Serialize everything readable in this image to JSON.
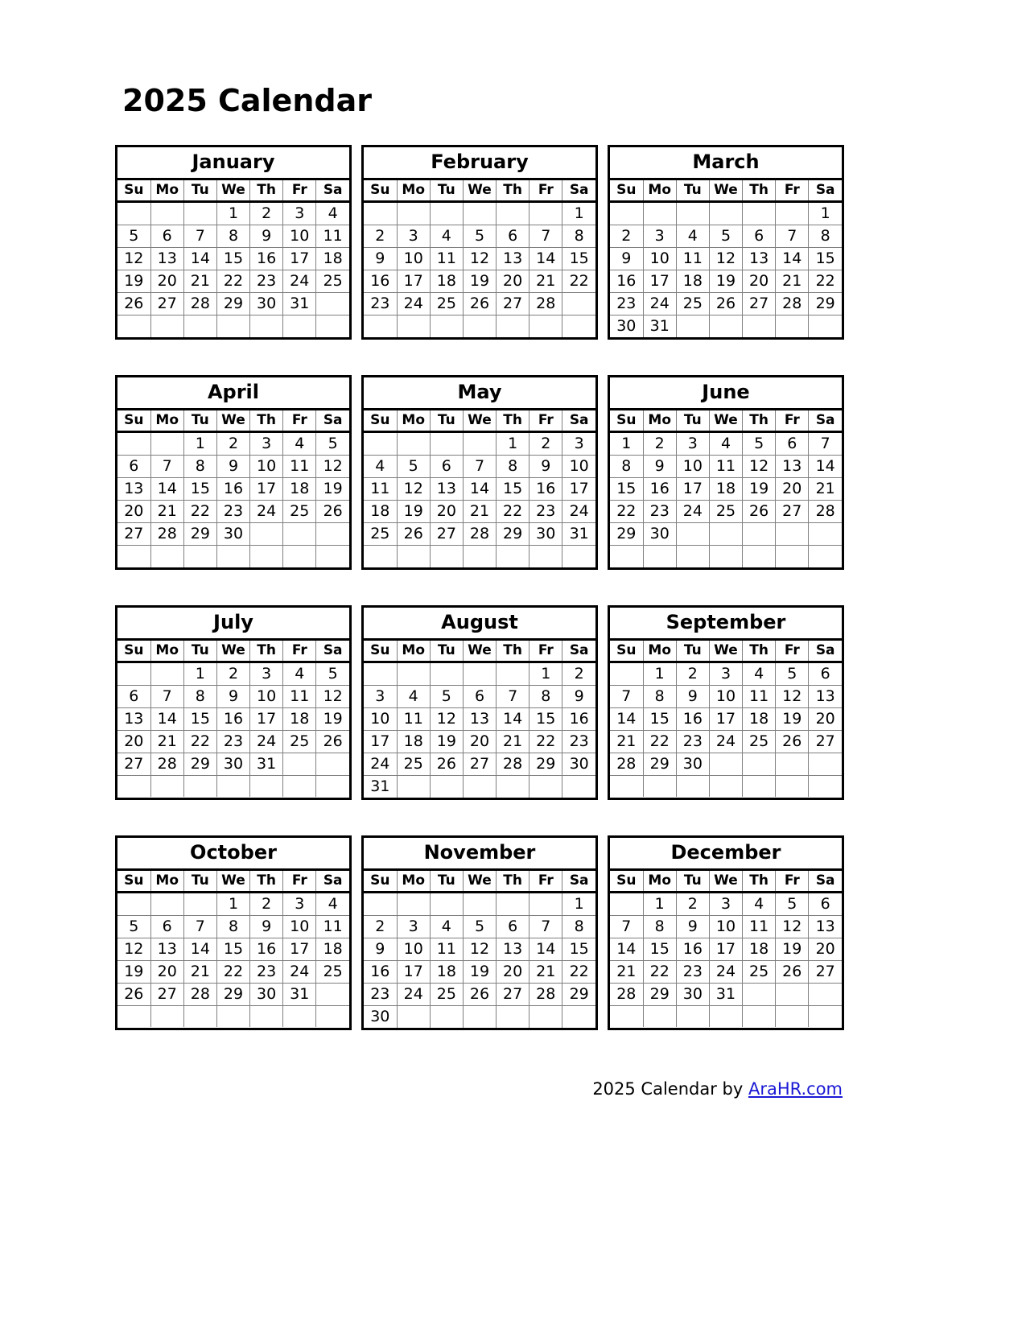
{
  "title": "2025 Calendar",
  "year": "2025",
  "weekdays": [
    "Su",
    "Mo",
    "Tu",
    "We",
    "Th",
    "Fr",
    "Sa"
  ],
  "footer": {
    "text": "2025  Calendar by ",
    "link_label": "AraHR.com",
    "link_color": "#1a19d4"
  },
  "colors": {
    "text": "#000000",
    "border_outer": "#000000",
    "border_inner": "#7f7f7f",
    "background": "#ffffff",
    "link": "#1a19d4"
  },
  "months": [
    {
      "name": "January",
      "weeks": [
        [
          "",
          "",
          "",
          "1",
          "2",
          "3",
          "4"
        ],
        [
          "5",
          "6",
          "7",
          "8",
          "9",
          "10",
          "11"
        ],
        [
          "12",
          "13",
          "14",
          "15",
          "16",
          "17",
          "18"
        ],
        [
          "19",
          "20",
          "21",
          "22",
          "23",
          "24",
          "25"
        ],
        [
          "26",
          "27",
          "28",
          "29",
          "30",
          "31",
          ""
        ],
        [
          "",
          "",
          "",
          "",
          "",
          "",
          ""
        ]
      ]
    },
    {
      "name": "February",
      "weeks": [
        [
          "",
          "",
          "",
          "",
          "",
          "",
          "1"
        ],
        [
          "2",
          "3",
          "4",
          "5",
          "6",
          "7",
          "8"
        ],
        [
          "9",
          "10",
          "11",
          "12",
          "13",
          "14",
          "15"
        ],
        [
          "16",
          "17",
          "18",
          "19",
          "20",
          "21",
          "22"
        ],
        [
          "23",
          "24",
          "25",
          "26",
          "27",
          "28",
          ""
        ],
        [
          "",
          "",
          "",
          "",
          "",
          "",
          ""
        ]
      ]
    },
    {
      "name": "March",
      "weeks": [
        [
          "",
          "",
          "",
          "",
          "",
          "",
          "1"
        ],
        [
          "2",
          "3",
          "4",
          "5",
          "6",
          "7",
          "8"
        ],
        [
          "9",
          "10",
          "11",
          "12",
          "13",
          "14",
          "15"
        ],
        [
          "16",
          "17",
          "18",
          "19",
          "20",
          "21",
          "22"
        ],
        [
          "23",
          "24",
          "25",
          "26",
          "27",
          "28",
          "29"
        ],
        [
          "30",
          "31",
          "",
          "",
          "",
          "",
          ""
        ]
      ]
    },
    {
      "name": "April",
      "weeks": [
        [
          "",
          "",
          "1",
          "2",
          "3",
          "4",
          "5"
        ],
        [
          "6",
          "7",
          "8",
          "9",
          "10",
          "11",
          "12"
        ],
        [
          "13",
          "14",
          "15",
          "16",
          "17",
          "18",
          "19"
        ],
        [
          "20",
          "21",
          "22",
          "23",
          "24",
          "25",
          "26"
        ],
        [
          "27",
          "28",
          "29",
          "30",
          "",
          "",
          ""
        ],
        [
          "",
          "",
          "",
          "",
          "",
          "",
          ""
        ]
      ]
    },
    {
      "name": "May",
      "weeks": [
        [
          "",
          "",
          "",
          "",
          "1",
          "2",
          "3"
        ],
        [
          "4",
          "5",
          "6",
          "7",
          "8",
          "9",
          "10"
        ],
        [
          "11",
          "12",
          "13",
          "14",
          "15",
          "16",
          "17"
        ],
        [
          "18",
          "19",
          "20",
          "21",
          "22",
          "23",
          "24"
        ],
        [
          "25",
          "26",
          "27",
          "28",
          "29",
          "30",
          "31"
        ],
        [
          "",
          "",
          "",
          "",
          "",
          "",
          ""
        ]
      ]
    },
    {
      "name": "June",
      "weeks": [
        [
          "1",
          "2",
          "3",
          "4",
          "5",
          "6",
          "7"
        ],
        [
          "8",
          "9",
          "10",
          "11",
          "12",
          "13",
          "14"
        ],
        [
          "15",
          "16",
          "17",
          "18",
          "19",
          "20",
          "21"
        ],
        [
          "22",
          "23",
          "24",
          "25",
          "26",
          "27",
          "28"
        ],
        [
          "29",
          "30",
          "",
          "",
          "",
          "",
          ""
        ],
        [
          "",
          "",
          "",
          "",
          "",
          "",
          ""
        ]
      ]
    },
    {
      "name": "July",
      "weeks": [
        [
          "",
          "",
          "1",
          "2",
          "3",
          "4",
          "5"
        ],
        [
          "6",
          "7",
          "8",
          "9",
          "10",
          "11",
          "12"
        ],
        [
          "13",
          "14",
          "15",
          "16",
          "17",
          "18",
          "19"
        ],
        [
          "20",
          "21",
          "22",
          "23",
          "24",
          "25",
          "26"
        ],
        [
          "27",
          "28",
          "29",
          "30",
          "31",
          "",
          ""
        ],
        [
          "",
          "",
          "",
          "",
          "",
          "",
          ""
        ]
      ]
    },
    {
      "name": "August",
      "weeks": [
        [
          "",
          "",
          "",
          "",
          "",
          "1",
          "2"
        ],
        [
          "3",
          "4",
          "5",
          "6",
          "7",
          "8",
          "9"
        ],
        [
          "10",
          "11",
          "12",
          "13",
          "14",
          "15",
          "16"
        ],
        [
          "17",
          "18",
          "19",
          "20",
          "21",
          "22",
          "23"
        ],
        [
          "24",
          "25",
          "26",
          "27",
          "28",
          "29",
          "30"
        ],
        [
          "31",
          "",
          "",
          "",
          "",
          "",
          ""
        ]
      ]
    },
    {
      "name": "September",
      "weeks": [
        [
          "",
          "1",
          "2",
          "3",
          "4",
          "5",
          "6"
        ],
        [
          "7",
          "8",
          "9",
          "10",
          "11",
          "12",
          "13"
        ],
        [
          "14",
          "15",
          "16",
          "17",
          "18",
          "19",
          "20"
        ],
        [
          "21",
          "22",
          "23",
          "24",
          "25",
          "26",
          "27"
        ],
        [
          "28",
          "29",
          "30",
          "",
          "",
          "",
          ""
        ],
        [
          "",
          "",
          "",
          "",
          "",
          "",
          ""
        ]
      ]
    },
    {
      "name": "October",
      "weeks": [
        [
          "",
          "",
          "",
          "1",
          "2",
          "3",
          "4"
        ],
        [
          "5",
          "6",
          "7",
          "8",
          "9",
          "10",
          "11"
        ],
        [
          "12",
          "13",
          "14",
          "15",
          "16",
          "17",
          "18"
        ],
        [
          "19",
          "20",
          "21",
          "22",
          "23",
          "24",
          "25"
        ],
        [
          "26",
          "27",
          "28",
          "29",
          "30",
          "31",
          ""
        ],
        [
          "",
          "",
          "",
          "",
          "",
          "",
          ""
        ]
      ]
    },
    {
      "name": "November",
      "weeks": [
        [
          "",
          "",
          "",
          "",
          "",
          "",
          "1"
        ],
        [
          "2",
          "3",
          "4",
          "5",
          "6",
          "7",
          "8"
        ],
        [
          "9",
          "10",
          "11",
          "12",
          "13",
          "14",
          "15"
        ],
        [
          "16",
          "17",
          "18",
          "19",
          "20",
          "21",
          "22"
        ],
        [
          "23",
          "24",
          "25",
          "26",
          "27",
          "28",
          "29"
        ],
        [
          "30",
          "",
          "",
          "",
          "",
          "",
          ""
        ]
      ]
    },
    {
      "name": "December",
      "weeks": [
        [
          "",
          "1",
          "2",
          "3",
          "4",
          "5",
          "6"
        ],
        [
          "7",
          "8",
          "9",
          "10",
          "11",
          "12",
          "13"
        ],
        [
          "14",
          "15",
          "16",
          "17",
          "18",
          "19",
          "20"
        ],
        [
          "21",
          "22",
          "23",
          "24",
          "25",
          "26",
          "27"
        ],
        [
          "28",
          "29",
          "30",
          "31",
          "",
          "",
          ""
        ],
        [
          "",
          "",
          "",
          "",
          "",
          "",
          ""
        ]
      ]
    }
  ]
}
